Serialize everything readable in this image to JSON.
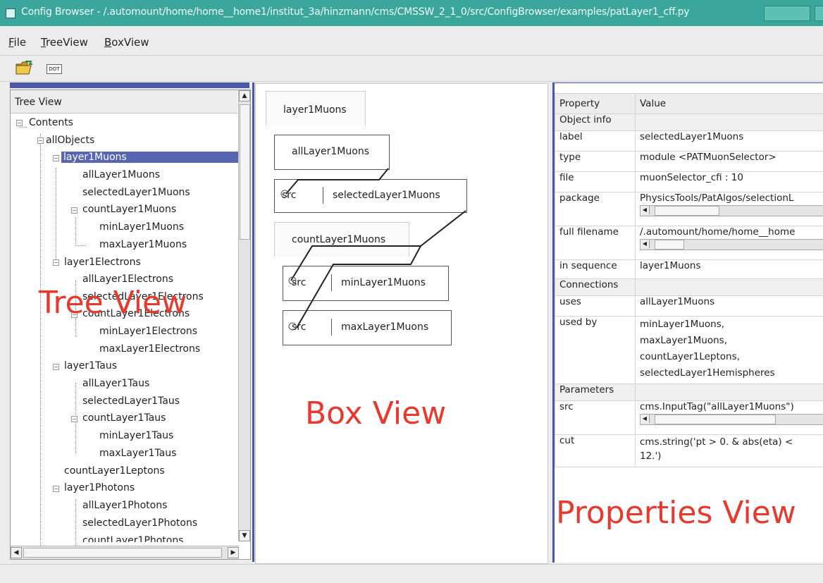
{
  "window": {
    "title": "Config Browser - /.automount/home/home__home1/institut_3a/hinzmann/cms/CMSSW_2_1_0/src/ConfigBrowser/examples/patLayer1_cff.py"
  },
  "menu": {
    "file": "File",
    "treeview": "TreeView",
    "boxview": "BoxView"
  },
  "toolbar": {
    "open_icon": "folder-open-icon",
    "dot_icon": "dot-export-icon",
    "dot_label": "DOT"
  },
  "tree": {
    "header": "Tree View",
    "nodes": [
      "Contents",
      "allObjects",
      "layer1Muons",
      "allLayer1Muons",
      "selectedLayer1Muons",
      "countLayer1Muons",
      "minLayer1Muons",
      "maxLayer1Muons",
      "layer1Electrons",
      "allLayer1Electrons",
      "selectedLayer1Electrons",
      "countLayer1Electrons",
      "minLayer1Electrons",
      "maxLayer1Electrons",
      "layer1Taus",
      "allLayer1Taus",
      "selectedLayer1Taus",
      "countLayer1Taus",
      "minLayer1Taus",
      "maxLayer1Taus",
      "countLayer1Leptons",
      "layer1Photons",
      "allLayer1Photons",
      "selectedLayer1Photons",
      "countLayer1Photons"
    ],
    "overlay": "Tree View"
  },
  "boxview": {
    "tab1": "layer1Muons",
    "box_all": "allLayer1Muons",
    "src": "src",
    "box_selected": "selectedLayer1Muons",
    "tab2": "countLayer1Muons",
    "box_min": "minLayer1Muons",
    "box_max": "maxLayer1Muons",
    "overlay": "Box View"
  },
  "props": {
    "col_property": "Property",
    "col_value": "Value",
    "sec_object": "Object info",
    "label_k": "label",
    "label_v": "selectedLayer1Muons",
    "type_k": "type",
    "type_v": "module <PATMuonSelector>",
    "file_k": "file",
    "file_v": "muonSelector_cfi : 10",
    "package_k": "package",
    "package_v": "PhysicsTools/PatAlgos/selectionL",
    "fullfile_k": "full filename",
    "fullfile_v": "/.automount/home/home__home",
    "inseq_k": "in sequence",
    "inseq_v": "layer1Muons",
    "sec_conn": "Connections",
    "uses_k": "uses",
    "uses_v": "allLayer1Muons",
    "usedby_k": "used by",
    "usedby_1": "minLayer1Muons,",
    "usedby_2": "maxLayer1Muons,",
    "usedby_3": "countLayer1Leptons,",
    "usedby_4": "selectedLayer1Hemispheres",
    "sec_params": "Parameters",
    "src_k": "src",
    "src_v": "cms.InputTag(\"allLayer1Muons\")",
    "cut_k": "cut",
    "cut_v1": "cms.string('pt > 0. & abs(eta) <",
    "cut_v2": "12.')",
    "overlay": "Properties View"
  }
}
